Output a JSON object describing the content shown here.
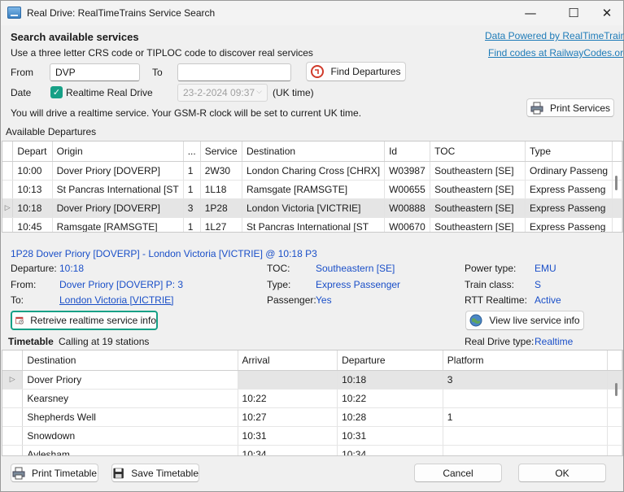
{
  "window": {
    "title": "Real Drive: RealTimeTrains Service Search",
    "minimize": "—",
    "maximize": "☐",
    "close": "✕"
  },
  "search": {
    "heading": "Search available services",
    "instructions": "Use a three letter CRS code or TIPLOC code to discover real services",
    "link_data": "Data Powered by RealTimeTrains",
    "link_codes": "Find codes at RailwayCodes.org",
    "from_label": "From",
    "from_value": "DVP",
    "to_label": "To",
    "to_value": "",
    "find_button": "Find Departures",
    "date_label": "Date",
    "realtime_checkbox_label": "Realtime Real Drive",
    "realtime_checked": true,
    "date_value": "23-2-2024 09:37",
    "uk_time": "(UK time)",
    "notice": "You will drive a realtime service. Your GSM-R clock will be set to current UK time.",
    "print_services": "Print Services"
  },
  "departures": {
    "label": "Available Departures",
    "columns": [
      "Depart",
      "Origin",
      "...",
      "Service",
      "Destination",
      "Id",
      "TOC",
      "Type"
    ],
    "rows": [
      {
        "depart": "10:00",
        "origin": "Dover Priory [DOVERP]",
        "plat": "1",
        "service": "2W30",
        "destination": "London Charing Cross [CHRX]",
        "id": "W03987",
        "toc": "Southeastern [SE]",
        "type": "Ordinary Passeng",
        "selected": false
      },
      {
        "depart": "10:13",
        "origin": "St Pancras International [ST",
        "plat": "1",
        "service": "1L18",
        "destination": "Ramsgate [RAMSGTE]",
        "id": "W00655",
        "toc": "Southeastern [SE]",
        "type": "Express Passeng",
        "selected": false
      },
      {
        "depart": "10:18",
        "origin": "Dover Priory [DOVERP]",
        "plat": "3",
        "service": "1P28",
        "destination": "London Victoria [VICTRIE]",
        "id": "W00888",
        "toc": "Southeastern [SE]",
        "type": "Express Passeng",
        "selected": true
      },
      {
        "depart": "10:45",
        "origin": "Ramsgate [RAMSGTE]",
        "plat": "1",
        "service": "1L27",
        "destination": "St Pancras International [ST",
        "id": "W00670",
        "toc": "Southeastern [SE]",
        "type": "Express Passeng",
        "selected": false
      }
    ]
  },
  "details": {
    "headline": "1P28 Dover Priory [DOVERP] - London Victoria [VICTRIE]  @ 10:18 P3",
    "departure_label": "Departure:",
    "departure_value": "10:18",
    "from_label": "From:",
    "from_value": "Dover Priory [DOVERP] P: 3",
    "to_label": "To:",
    "to_value": "London Victoria [VICTRIE]",
    "toc_label": "TOC:",
    "toc_value": "Southeastern [SE]",
    "type_label": "Type:",
    "type_value": "Express Passenger",
    "passenger_label": "Passenger:",
    "passenger_value": "Yes",
    "power_label": "Power type:",
    "power_value": "EMU",
    "class_label": "Train class:",
    "class_value": "S",
    "rtt_label": "RTT Realtime:",
    "rtt_value": "Active",
    "retrieve_button": "Retreive realtime service info",
    "live_button": "View live service info",
    "realdrive_label": "Real Drive type:",
    "realdrive_value": "Realtime"
  },
  "timetable": {
    "title": "Timetable",
    "calling": "Calling at 19 stations",
    "columns": [
      "Destination",
      "Arrival",
      "Departure",
      "Platform"
    ],
    "rows": [
      {
        "destination": "Dover Priory",
        "arrival": "",
        "departure": "10:18",
        "platform": "3",
        "selected": true
      },
      {
        "destination": "Kearsney",
        "arrival": "10:22",
        "departure": "10:22",
        "platform": "",
        "selected": false
      },
      {
        "destination": "Shepherds Well",
        "arrival": "10:27",
        "departure": "10:28",
        "platform": "1",
        "selected": false
      },
      {
        "destination": "Snowdown",
        "arrival": "10:31",
        "departure": "10:31",
        "platform": "",
        "selected": false
      },
      {
        "destination": "Aylesham",
        "arrival": "10:34",
        "departure": "10:34",
        "platform": "",
        "selected": false
      }
    ]
  },
  "footer": {
    "print_timetable": "Print Timetable",
    "save_timetable": "Save Timetable",
    "cancel": "Cancel",
    "ok": "OK"
  },
  "colors": {
    "accent": "#16a086",
    "link": "#1e7bb8",
    "value_blue": "#1a4fc8"
  },
  "icons": [
    "app-icon",
    "find-departures-icon",
    "printer-icon",
    "row-pointer-icon",
    "retrieve-icon",
    "globe-icon",
    "save-icon",
    "check-icon"
  ]
}
